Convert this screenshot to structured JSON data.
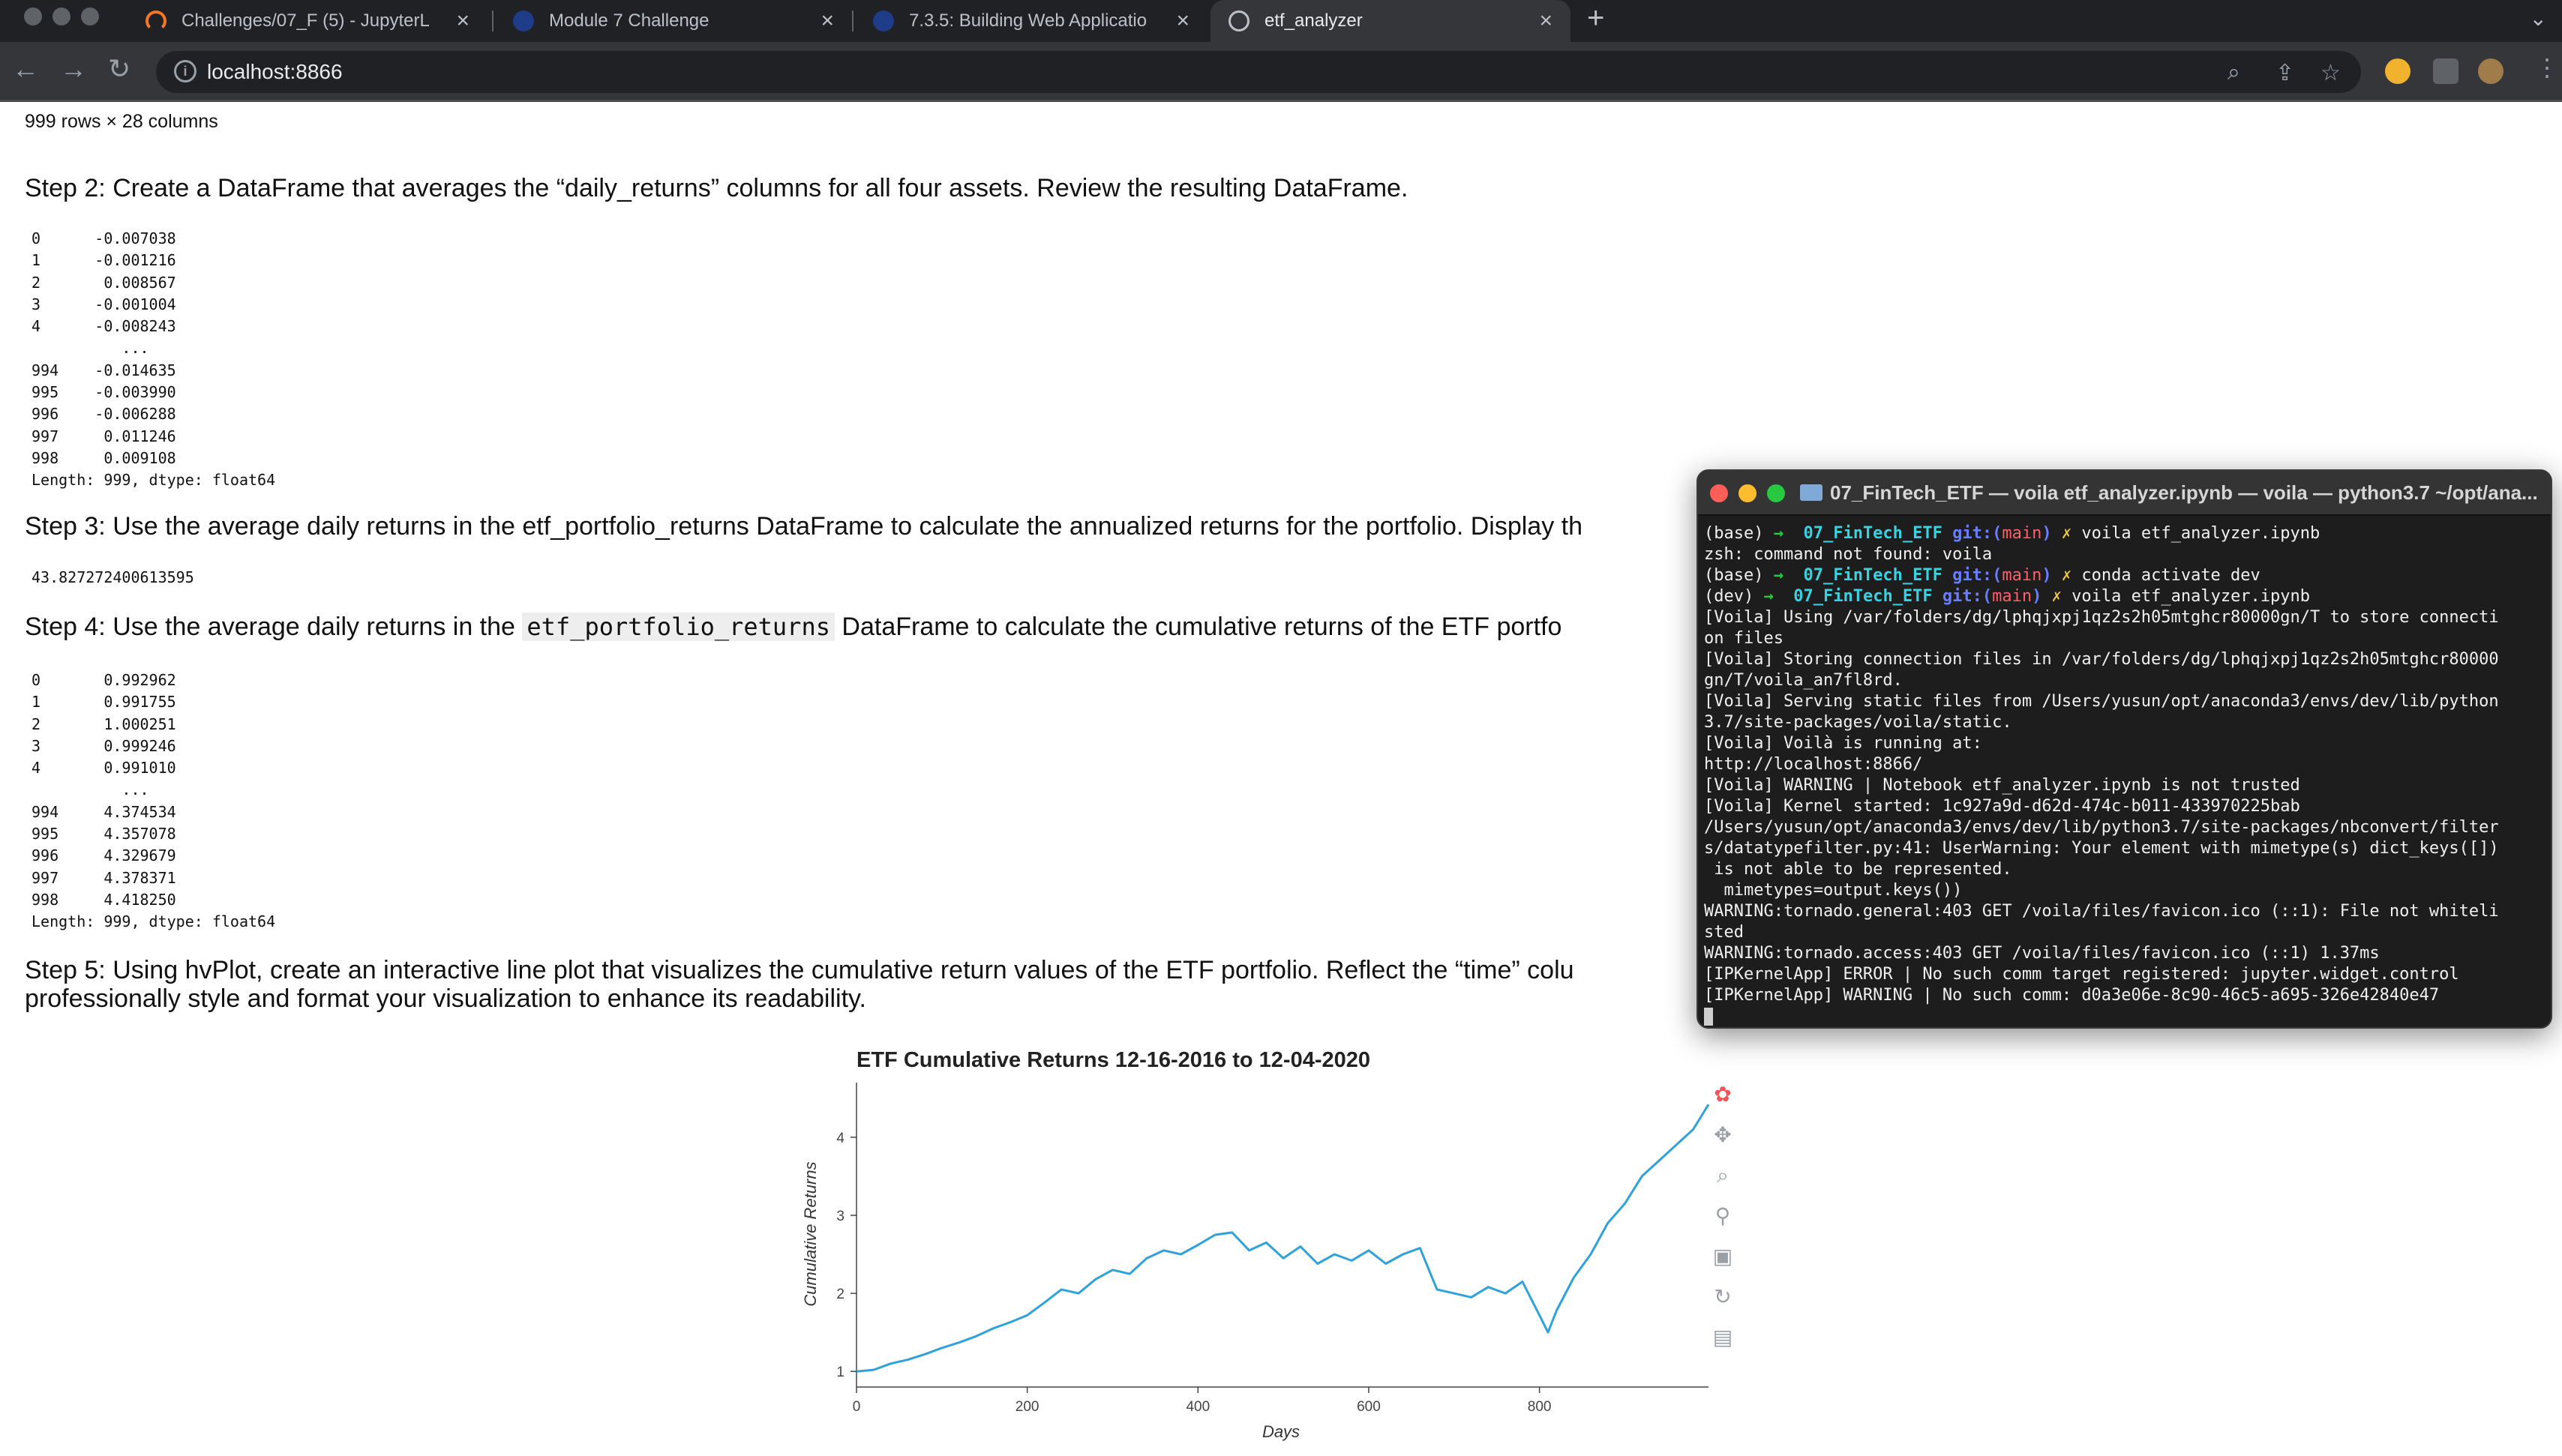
{
  "browser": {
    "tabs": [
      {
        "title": "Challenges/07_F (5) - JupyterL",
        "icon": "jupyter-icon",
        "active": false
      },
      {
        "title": "Module 7 Challenge",
        "icon": "bootcamp-icon",
        "active": false
      },
      {
        "title": "7.3.5: Building Web Applicatio",
        "icon": "bootcamp-icon",
        "active": false
      },
      {
        "title": "etf_analyzer",
        "icon": "globe-icon",
        "active": true
      }
    ],
    "url": "localhost:8866",
    "colors": {
      "tabbar": "#202124",
      "toolbar": "#35363a",
      "active_tab": "#35363a"
    }
  },
  "notebook": {
    "rows_cols": "999 rows × 28 columns",
    "step2": "Step 2: Create a DataFrame that averages the “daily_returns” columns for all four assets. Review the resulting DataFrame.",
    "step2_output": "0      -0.007038\n1      -0.001216\n2       0.008567\n3      -0.001004\n4      -0.008243\n          ...\n994    -0.014635\n995    -0.003990\n996    -0.006288\n997     0.011246\n998     0.009108\nLength: 999, dtype: float64",
    "step3": "Step 3: Use the average daily returns in the etf_portfolio_returns DataFrame to calculate the annualized returns for the portfolio. Display th",
    "step3_output": "43.827272400613595",
    "step4_pre": "Step 4: Use the average daily returns in the ",
    "step4_code": "etf_portfolio_returns",
    "step4_post": " DataFrame to calculate the cumulative returns of the ETF portfo",
    "step4_output": "0       0.992962\n1       0.991755\n2       1.000251\n3       0.999246\n4       0.991010\n          ...\n994     4.374534\n995     4.357078\n996     4.329679\n997     4.378371\n998     4.418250\nLength: 999, dtype: float64",
    "step5_line1": "Step 5: Using hvPlot, create an interactive line plot that visualizes the cumulative return values of the ETF portfolio. Reflect the “time” colu",
    "step5_line2": "professionally style and format your visualization to enhance its readability."
  },
  "chart_data": {
    "type": "line",
    "title": "ETF Cumulative Returns 12-16-2016 to 12-04-2020",
    "xlabel": "Days",
    "ylabel": "Cumulative Returns",
    "xlim": [
      0,
      998
    ],
    "ylim": [
      0.8,
      4.7
    ],
    "xticks": [
      0,
      200,
      400,
      600,
      800
    ],
    "yticks": [
      1,
      2,
      3,
      4
    ],
    "line_color": "#30a2da",
    "series": [
      {
        "x": [
          0,
          20,
          40,
          60,
          80,
          100,
          120,
          140,
          160,
          180,
          200,
          220,
          240,
          260,
          280,
          300,
          320,
          340,
          360,
          380,
          400,
          420,
          440,
          460,
          480,
          500,
          520,
          540,
          560,
          580,
          600,
          620,
          640,
          660,
          680,
          700,
          720,
          740,
          760,
          780,
          800,
          810,
          820,
          840,
          860,
          880,
          900,
          920,
          940,
          960,
          980,
          998
        ],
        "y": [
          1.0,
          1.02,
          1.1,
          1.15,
          1.22,
          1.3,
          1.37,
          1.45,
          1.55,
          1.63,
          1.72,
          1.88,
          2.05,
          2.0,
          2.18,
          2.3,
          2.25,
          2.45,
          2.55,
          2.5,
          2.62,
          2.75,
          2.78,
          2.55,
          2.65,
          2.45,
          2.6,
          2.38,
          2.5,
          2.42,
          2.55,
          2.38,
          2.5,
          2.58,
          2.05,
          2.0,
          1.95,
          2.08,
          2.0,
          2.15,
          1.72,
          1.5,
          1.78,
          2.2,
          2.5,
          2.9,
          3.15,
          3.5,
          3.7,
          3.9,
          4.1,
          4.42
        ]
      }
    ]
  },
  "terminal": {
    "title": "07_FinTech_ETF — voila etf_analyzer.ipynb — voila — python3.7 ~/opt/ana...",
    "lines": [
      {
        "env": "(base)",
        "dir": "07_FinTech_ETF",
        "git": "git:(main)",
        "cmd": "voila etf_analyzer.ipynb"
      },
      {
        "text": "zsh: command not found: voila"
      },
      {
        "env": "(base)",
        "dir": "07_FinTech_ETF",
        "git": "git:(main)",
        "cmd": "conda activate dev"
      },
      {
        "env": "(dev)",
        "dir": "07_FinTech_ETF",
        "git": "git:(main)",
        "cmd": "voila etf_analyzer.ipynb"
      },
      {
        "text": "[Voila] Using /var/folders/dg/lphqjxpj1qz2s2h05mtghcr80000gn/T to store connecti"
      },
      {
        "text": "on files"
      },
      {
        "text": "[Voila] Storing connection files in /var/folders/dg/lphqjxpj1qz2s2h05mtghcr80000"
      },
      {
        "text": "gn/T/voila_an7fl8rd."
      },
      {
        "text": "[Voila] Serving static files from /Users/yusun/opt/anaconda3/envs/dev/lib/python"
      },
      {
        "text": "3.7/site-packages/voila/static."
      },
      {
        "text": "[Voila] Voilà is running at:"
      },
      {
        "text": "http://localhost:8866/"
      },
      {
        "text": "[Voila] WARNING | Notebook etf_analyzer.ipynb is not trusted"
      },
      {
        "text": "[Voila] Kernel started: 1c927a9d-d62d-474c-b011-433970225bab"
      },
      {
        "text": "/Users/yusun/opt/anaconda3/envs/dev/lib/python3.7/site-packages/nbconvert/filter"
      },
      {
        "text": "s/datatypefilter.py:41: UserWarning: Your element with mimetype(s) dict_keys([])"
      },
      {
        "text": " is not able to be represented."
      },
      {
        "text": "  mimetypes=output.keys())"
      },
      {
        "text": "WARNING:tornado.general:403 GET /voila/files/favicon.ico (::1): File not whiteli"
      },
      {
        "text": "sted"
      },
      {
        "text": "WARNING:tornado.access:403 GET /voila/files/favicon.ico (::1) 1.37ms"
      },
      {
        "text": "[IPKernelApp] ERROR | No such comm target registered: jupyter.widget.control"
      },
      {
        "text": "[IPKernelApp] WARNING | No such comm: d0a3e06e-8c90-46c5-a695-326e42840e47"
      }
    ]
  }
}
